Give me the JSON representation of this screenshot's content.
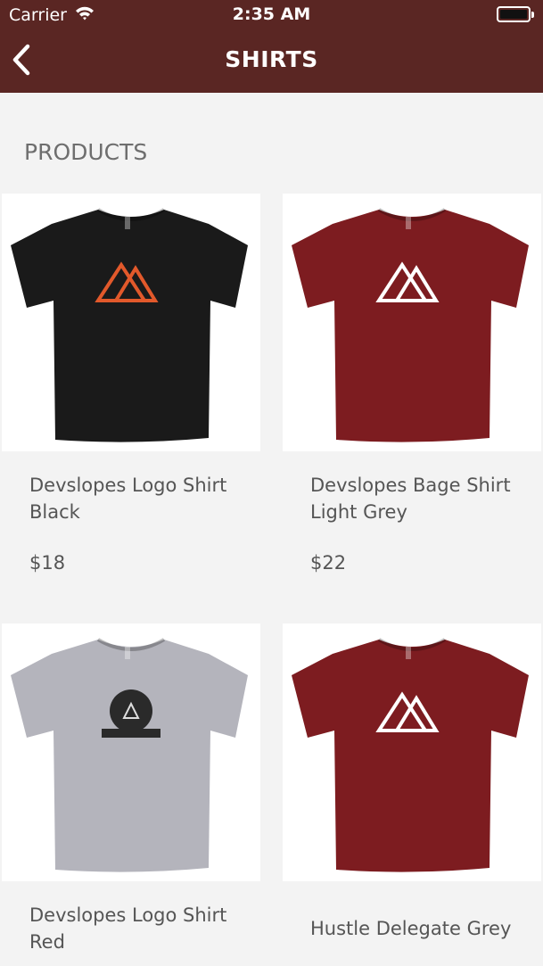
{
  "status_bar": {
    "carrier": "Carrier",
    "time": "2:35 AM"
  },
  "nav": {
    "title": "SHIRTS"
  },
  "section_title": "PRODUCTS",
  "colors": {
    "header": "#5a2623",
    "background": "#f3f3f3"
  },
  "products": [
    {
      "name": "Devslopes Logo Shirt Black",
      "price": "$18",
      "shirt_color": "#1a1a1a",
      "logo": "mountain-icon",
      "logo_color": "#e2592b"
    },
    {
      "name": "Devslopes Bage Shirt Light Grey",
      "price": "$22",
      "shirt_color": "#7d1c20",
      "logo": "mountain-icon",
      "logo_color": "#ffffff"
    },
    {
      "name": "Devslopes Logo Shirt Red",
      "price": "",
      "shirt_color": "#b4b4bc",
      "logo": "badge-icon",
      "logo_color": "#2a2a2a"
    },
    {
      "name": "Hustle Delegate Grey",
      "price": "",
      "shirt_color": "#7d1c20",
      "logo": "mountain-icon",
      "logo_color": "#ffffff"
    }
  ]
}
